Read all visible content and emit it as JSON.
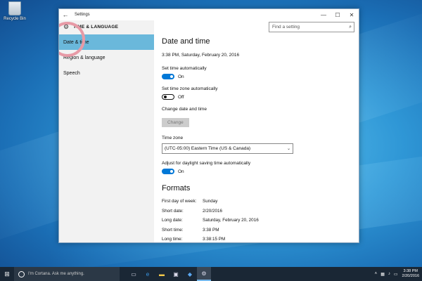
{
  "desktop": {
    "recycle_label": "Recycle Bin"
  },
  "window": {
    "title": "Settings",
    "back_glyph": "←",
    "controls": {
      "minimize": "—",
      "maximize": "☐",
      "close": "✕"
    }
  },
  "sidebar": {
    "app_title": "TIME & LANGUAGE",
    "items": [
      {
        "label": "Date & time"
      },
      {
        "label": "Region & language"
      },
      {
        "label": "Speech"
      }
    ]
  },
  "search": {
    "placeholder": "Find a setting"
  },
  "main": {
    "heading": "Date and time",
    "current_datetime": "3:38 PM, Saturday, February 20, 2016",
    "set_time_auto": {
      "label": "Set time automatically",
      "state": "On"
    },
    "set_timezone_auto": {
      "label": "Set time zone automatically",
      "state": "Off"
    },
    "change": {
      "label": "Change date and time",
      "button": "Change"
    },
    "timezone": {
      "label": "Time zone",
      "value": "(UTC-05:00) Eastern Time (US & Canada)"
    },
    "dst": {
      "label": "Adjust for daylight saving time automatically",
      "state": "On"
    },
    "formats": {
      "heading": "Formats",
      "rows": [
        {
          "label": "First day of week:",
          "value": "Sunday"
        },
        {
          "label": "Short date:",
          "value": "2/20/2016"
        },
        {
          "label": "Long date:",
          "value": "Saturday, February 20, 2016"
        },
        {
          "label": "Short time:",
          "value": "3:38 PM"
        },
        {
          "label": "Long time:",
          "value": "3:38:15 PM"
        }
      ]
    }
  },
  "taskbar": {
    "cortana_placeholder": "I'm Cortana. Ask me anything.",
    "clock_time": "3:38 PM",
    "clock_date": "2/20/2016"
  },
  "colors": {
    "accent": "#0078d7",
    "nav_active": "#6ab8db",
    "taskbar": "#1a2735"
  }
}
